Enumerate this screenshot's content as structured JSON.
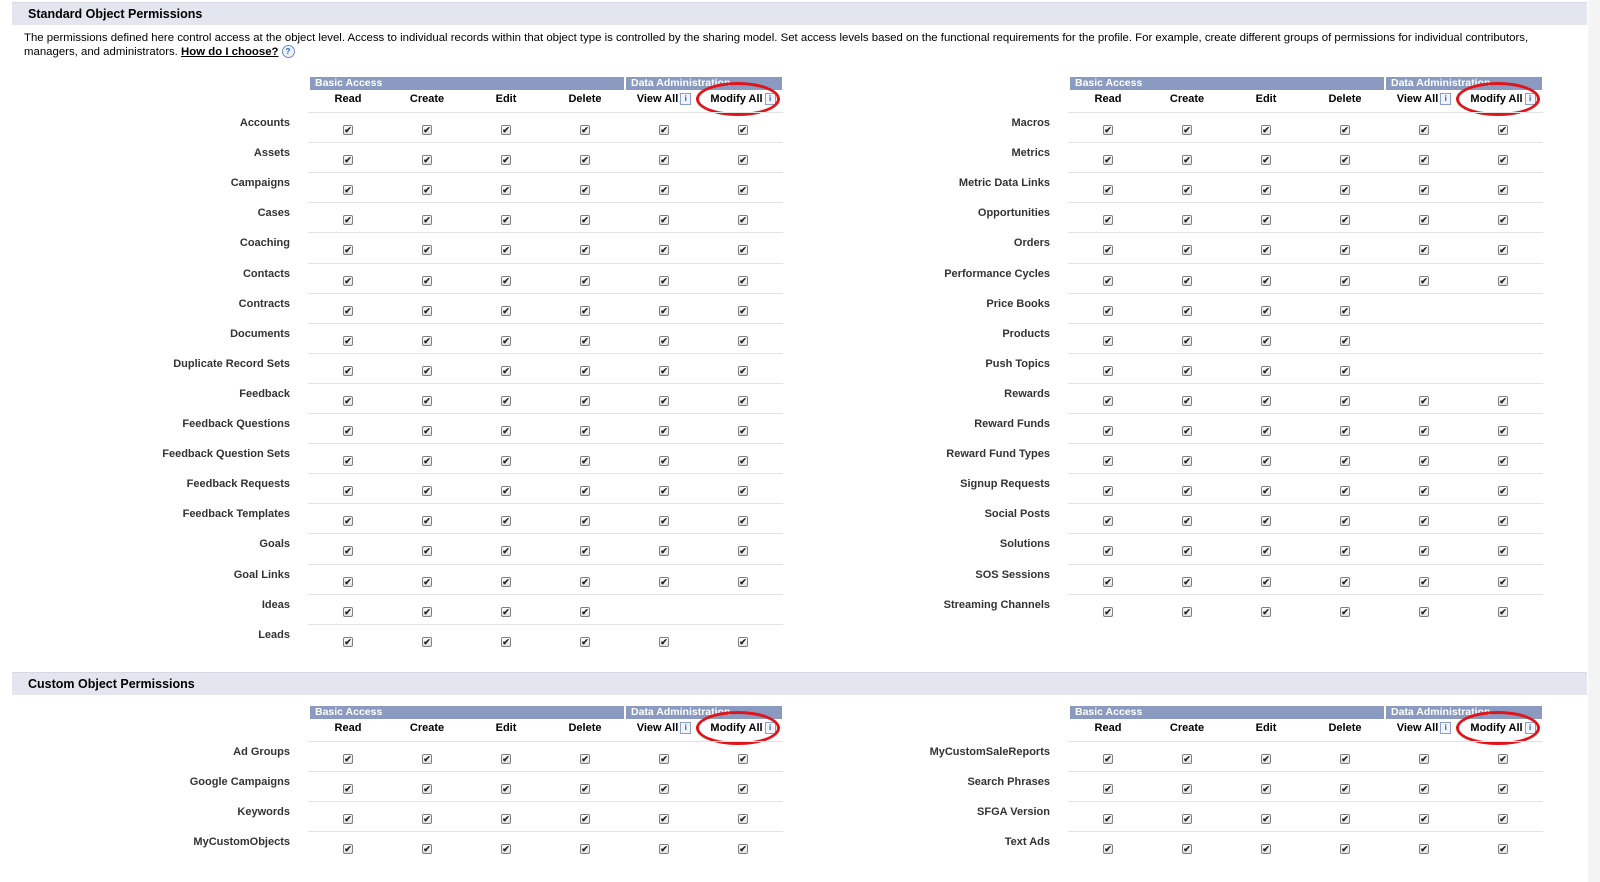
{
  "standard": {
    "title": "Standard Object Permissions",
    "description": "The permissions defined here control access at the object level. Access to individual records within that object type is controlled by the sharing model. Set access levels based on the functional requirements for the profile. For example, create different groups of permissions for individual contributors, managers, and administrators.",
    "how_link": "How do I choose?",
    "left": [
      {
        "name": "Accounts",
        "checks": [
          1,
          1,
          1,
          1,
          1,
          1
        ]
      },
      {
        "name": "Assets",
        "checks": [
          1,
          1,
          1,
          1,
          1,
          1
        ]
      },
      {
        "name": "Campaigns",
        "checks": [
          1,
          1,
          1,
          1,
          1,
          1
        ]
      },
      {
        "name": "Cases",
        "checks": [
          1,
          1,
          1,
          1,
          1,
          1
        ]
      },
      {
        "name": "Coaching",
        "checks": [
          1,
          1,
          1,
          1,
          1,
          1
        ]
      },
      {
        "name": "Contacts",
        "checks": [
          1,
          1,
          1,
          1,
          1,
          1
        ]
      },
      {
        "name": "Contracts",
        "checks": [
          1,
          1,
          1,
          1,
          1,
          1
        ]
      },
      {
        "name": "Documents",
        "checks": [
          1,
          1,
          1,
          1,
          1,
          1
        ]
      },
      {
        "name": "Duplicate Record Sets",
        "checks": [
          1,
          1,
          1,
          1,
          1,
          1
        ]
      },
      {
        "name": "Feedback",
        "checks": [
          1,
          1,
          1,
          1,
          1,
          1
        ]
      },
      {
        "name": "Feedback Questions",
        "checks": [
          1,
          1,
          1,
          1,
          1,
          1
        ]
      },
      {
        "name": "Feedback Question Sets",
        "checks": [
          1,
          1,
          1,
          1,
          1,
          1
        ]
      },
      {
        "name": "Feedback Requests",
        "checks": [
          1,
          1,
          1,
          1,
          1,
          1
        ]
      },
      {
        "name": "Feedback Templates",
        "checks": [
          1,
          1,
          1,
          1,
          1,
          1
        ]
      },
      {
        "name": "Goals",
        "checks": [
          1,
          1,
          1,
          1,
          1,
          1
        ]
      },
      {
        "name": "Goal Links",
        "checks": [
          1,
          1,
          1,
          1,
          1,
          1
        ]
      },
      {
        "name": "Ideas",
        "checks": [
          1,
          1,
          1,
          1,
          0,
          0
        ]
      },
      {
        "name": "Leads",
        "checks": [
          1,
          1,
          1,
          1,
          1,
          1
        ]
      }
    ],
    "right": [
      {
        "name": "Macros",
        "checks": [
          1,
          1,
          1,
          1,
          1,
          1
        ]
      },
      {
        "name": "Metrics",
        "checks": [
          1,
          1,
          1,
          1,
          1,
          1
        ]
      },
      {
        "name": "Metric Data Links",
        "checks": [
          1,
          1,
          1,
          1,
          1,
          1
        ]
      },
      {
        "name": "Opportunities",
        "checks": [
          1,
          1,
          1,
          1,
          1,
          1
        ]
      },
      {
        "name": "Orders",
        "checks": [
          1,
          1,
          1,
          1,
          1,
          1
        ]
      },
      {
        "name": "Performance Cycles",
        "checks": [
          1,
          1,
          1,
          1,
          1,
          1
        ]
      },
      {
        "name": "Price Books",
        "checks": [
          1,
          1,
          1,
          1,
          0,
          0
        ]
      },
      {
        "name": "Products",
        "checks": [
          1,
          1,
          1,
          1,
          0,
          0
        ]
      },
      {
        "name": "Push Topics",
        "checks": [
          1,
          1,
          1,
          1,
          0,
          0
        ]
      },
      {
        "name": "Rewards",
        "checks": [
          1,
          1,
          1,
          1,
          1,
          1
        ]
      },
      {
        "name": "Reward Funds",
        "checks": [
          1,
          1,
          1,
          1,
          1,
          1
        ]
      },
      {
        "name": "Reward Fund Types",
        "checks": [
          1,
          1,
          1,
          1,
          1,
          1
        ]
      },
      {
        "name": "Signup Requests",
        "checks": [
          1,
          1,
          1,
          1,
          1,
          1
        ]
      },
      {
        "name": "Social Posts",
        "checks": [
          1,
          1,
          1,
          1,
          1,
          1
        ]
      },
      {
        "name": "Solutions",
        "checks": [
          1,
          1,
          1,
          1,
          1,
          1
        ]
      },
      {
        "name": "SOS Sessions",
        "checks": [
          1,
          1,
          1,
          1,
          1,
          1
        ]
      },
      {
        "name": "Streaming Channels",
        "checks": [
          1,
          1,
          1,
          1,
          1,
          1
        ]
      }
    ]
  },
  "custom": {
    "title": "Custom Object Permissions",
    "left": [
      {
        "name": "Ad Groups",
        "checks": [
          1,
          1,
          1,
          1,
          1,
          1
        ]
      },
      {
        "name": "Google Campaigns",
        "checks": [
          1,
          1,
          1,
          1,
          1,
          1
        ]
      },
      {
        "name": "Keywords",
        "checks": [
          1,
          1,
          1,
          1,
          1,
          1
        ]
      },
      {
        "name": "MyCustomObjects",
        "checks": [
          1,
          1,
          1,
          1,
          1,
          1
        ]
      }
    ],
    "right": [
      {
        "name": "MyCustomSaleReports",
        "checks": [
          1,
          1,
          1,
          1,
          1,
          1
        ]
      },
      {
        "name": "Search Phrases",
        "checks": [
          1,
          1,
          1,
          1,
          1,
          1
        ]
      },
      {
        "name": "SFGA Version",
        "checks": [
          1,
          1,
          1,
          1,
          1,
          1
        ]
      },
      {
        "name": "Text Ads",
        "checks": [
          1,
          1,
          1,
          1,
          1,
          1
        ]
      }
    ]
  },
  "groups": {
    "basic": "Basic Access",
    "admin": "Data Administration"
  },
  "columns": [
    "Read",
    "Create",
    "Edit",
    "Delete",
    "View All",
    "Modify All"
  ],
  "checkmark": "✔",
  "colors": {
    "section_bg": "#e3e6ef",
    "group_header_bg": "#8a9ac1",
    "highlight_circle": "#e0141a"
  }
}
